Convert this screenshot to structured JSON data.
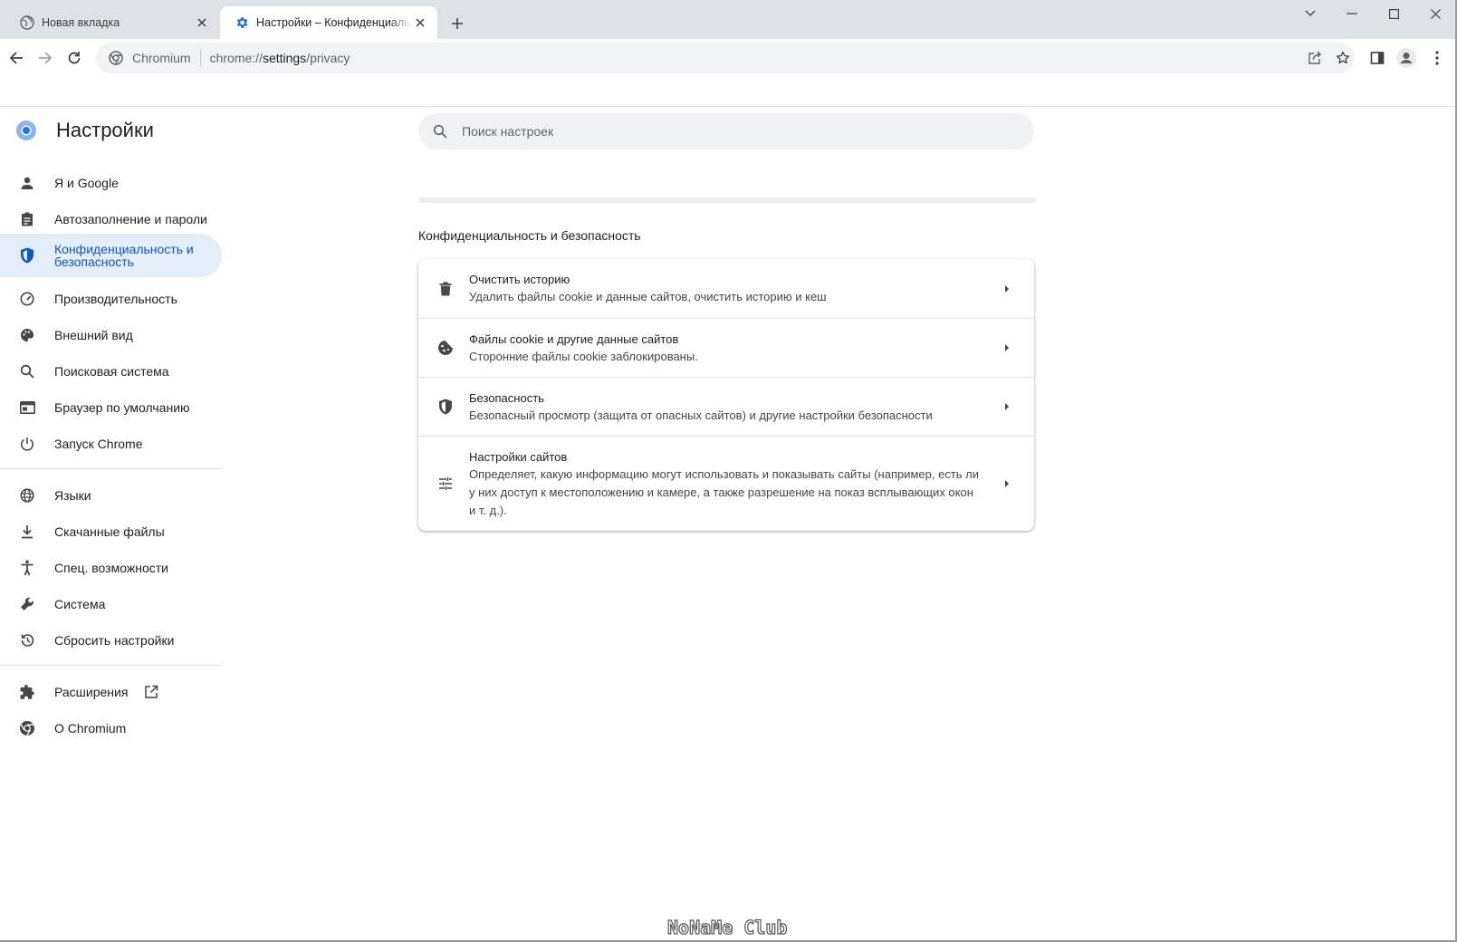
{
  "tabs": [
    {
      "title": "Новая вкладка",
      "icon": "globe-icon",
      "active": false
    },
    {
      "title": "Настройки – Конфиденциальность и безопасность",
      "icon": "gear-icon",
      "active": true
    }
  ],
  "toolbar": {
    "origin": "Chromium",
    "url_prefix": "chrome://",
    "url_host": "settings",
    "url_path": "/privacy"
  },
  "sidebar": {
    "title": "Настройки",
    "items": [
      {
        "label": "Я и Google",
        "icon": "person-icon"
      },
      {
        "label": "Автозаполнение и пароли",
        "icon": "clipboard-icon"
      },
      {
        "label": "Конфиденциальность и безопасность",
        "icon": "shield-icon",
        "selected": true
      },
      {
        "label": "Производительность",
        "icon": "speedometer-icon"
      },
      {
        "label": "Внешний вид",
        "icon": "palette-icon"
      },
      {
        "label": "Поисковая система",
        "icon": "search-icon"
      },
      {
        "label": "Браузер по умолчанию",
        "icon": "browser-icon"
      },
      {
        "label": "Запуск Chrome",
        "icon": "power-icon"
      },
      {
        "label": "Языки",
        "icon": "globe-icon"
      },
      {
        "label": "Скачанные файлы",
        "icon": "download-icon"
      },
      {
        "label": "Спец. возможности",
        "icon": "accessibility-icon"
      },
      {
        "label": "Система",
        "icon": "wrench-icon"
      },
      {
        "label": "Сбросить настройки",
        "icon": "history-icon"
      },
      {
        "label": "Расширения",
        "icon": "puzzle-icon"
      },
      {
        "label": "О Chromium",
        "icon": "chromium-icon"
      }
    ]
  },
  "search": {
    "placeholder": "Поиск настроек"
  },
  "section": {
    "title": "Конфиденциальность и безопасность",
    "rows": [
      {
        "title": "Очистить историю",
        "subtitle": "Удалить файлы cookie и данные сайтов, очистить историю и кеш",
        "icon": "trash-icon"
      },
      {
        "title": "Файлы cookie и другие данные сайтов",
        "subtitle": "Сторонние файлы cookie заблокированы.",
        "icon": "cookie-icon"
      },
      {
        "title": "Безопасность",
        "subtitle": "Безопасный просмотр (защита от опасных сайтов) и другие настройки безопасности",
        "icon": "shield-icon"
      },
      {
        "title": "Настройки сайтов",
        "subtitle": "Определяет, какую информацию могут использовать и показывать сайты (например, есть ли у них доступ к местоположению и камере, а также разрешение на показ всплывающих окон и т. д.).",
        "icon": "tune-icon"
      }
    ]
  },
  "watermark": "NoNaMe Club",
  "colors": {
    "accent": "#0b57d0",
    "selected_bg": "#e5edf8"
  }
}
